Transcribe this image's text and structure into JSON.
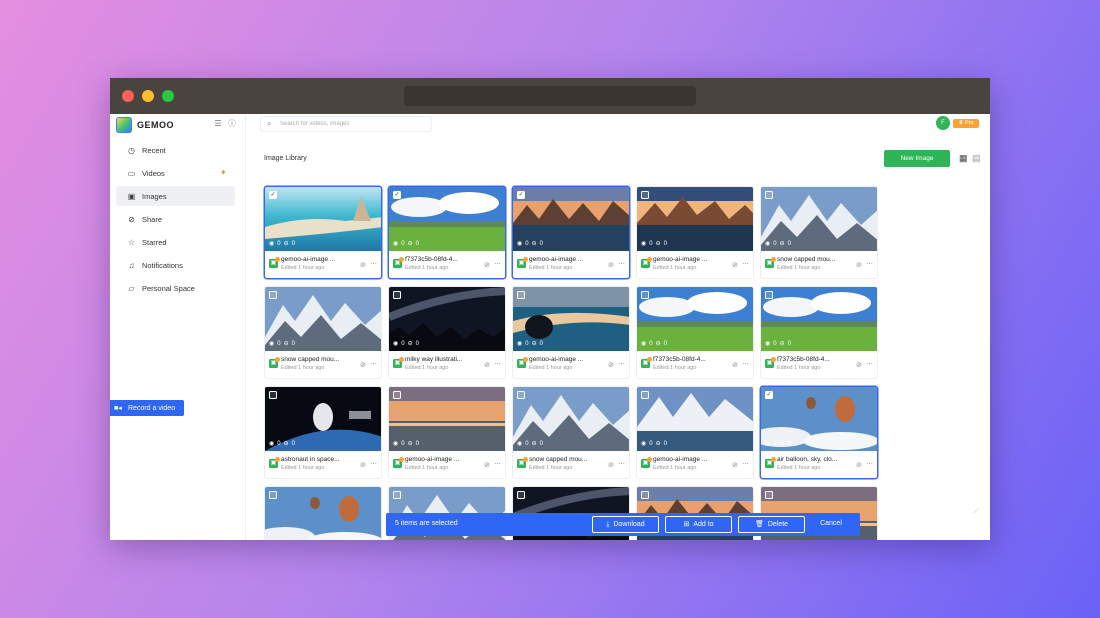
{
  "app": {
    "name": "GEMOO"
  },
  "sidebar": {
    "items": [
      {
        "label": "Recent",
        "icon": "clock-icon"
      },
      {
        "label": "Videos",
        "icon": "video-icon"
      },
      {
        "label": "Images",
        "icon": "image-icon",
        "active": true
      },
      {
        "label": "Share",
        "icon": "share-icon"
      },
      {
        "label": "Starred",
        "icon": "star-icon"
      },
      {
        "label": "Notifications",
        "icon": "bell-icon"
      },
      {
        "label": "Personal Space",
        "icon": "folder-icon"
      }
    ],
    "record_label": "Record a video"
  },
  "header": {
    "search_placeholder": "Search for videos, images",
    "avatar_initial": "F",
    "badge": "Pro"
  },
  "main": {
    "title": "Image Library",
    "new_button": "New Image"
  },
  "cards": [
    {
      "name": "gemoo-ai-image ...",
      "edited": "Edited 1 hour ago",
      "views": "0",
      "comments": "0",
      "selected": true,
      "scene": "beach"
    },
    {
      "name": "f7373c5b-08fd-4...",
      "edited": "Edited 1 hour ago",
      "views": "0",
      "comments": "0",
      "selected": true,
      "scene": "meadow"
    },
    {
      "name": "gemoo-ai-image ...",
      "edited": "Edited 1 hour ago",
      "views": "0",
      "comments": "0",
      "selected": true,
      "scene": "lake-sunset"
    },
    {
      "name": "gemoo-ai-image ...",
      "edited": "Edited 1 hour ago",
      "views": "0",
      "comments": "0",
      "selected": false,
      "scene": "lake-sunset2"
    },
    {
      "name": "snow capped mou...",
      "edited": "Edited 1 hour ago",
      "views": "0",
      "comments": "0",
      "selected": false,
      "scene": "snow"
    },
    {
      "name": "snow capped mou...",
      "edited": "Edited 1 hour ago",
      "views": "0",
      "comments": "0",
      "selected": false,
      "scene": "snow"
    },
    {
      "name": "milky way illustrati...",
      "edited": "Edited 1 hour ago",
      "views": "0",
      "comments": "0",
      "selected": false,
      "scene": "milkyway"
    },
    {
      "name": "gemoo-ai-image ...",
      "edited": "Edited 1 hour ago",
      "views": "0",
      "comments": "0",
      "selected": false,
      "scene": "lagoon"
    },
    {
      "name": "f7373c5b-08fd-4...",
      "edited": "Edited 1 hour ago",
      "views": "0",
      "comments": "0",
      "selected": false,
      "scene": "meadow"
    },
    {
      "name": "f7373c5b-08fd-4...",
      "edited": "Edited 1 hour ago",
      "views": "0",
      "comments": "0",
      "selected": false,
      "scene": "meadow"
    },
    {
      "name": "astronaut in space...",
      "edited": "Edited 1 hour ago",
      "views": "0",
      "comments": "0",
      "selected": false,
      "scene": "space"
    },
    {
      "name": "gemoo-ai-image ...",
      "edited": "Edited 1 hour ago",
      "views": "0",
      "comments": "0",
      "selected": false,
      "scene": "sea-sunset"
    },
    {
      "name": "snow capped mou...",
      "edited": "Edited 1 hour ago",
      "views": "0",
      "comments": "0",
      "selected": false,
      "scene": "snow"
    },
    {
      "name": "gemoo-ai-image ...",
      "edited": "Edited 1 hour ago",
      "views": "0",
      "comments": "0",
      "selected": false,
      "scene": "snow-lake"
    },
    {
      "name": "air balloon, sky, clo...",
      "edited": "Edited 1 hour ago",
      "views": "0",
      "comments": "0",
      "selected": true,
      "scene": "balloon"
    },
    {
      "name": "",
      "edited": "",
      "views": "",
      "comments": "",
      "selected": false,
      "scene": "balloon"
    },
    {
      "name": "",
      "edited": "",
      "views": "",
      "comments": "",
      "selected": false,
      "scene": "snow"
    },
    {
      "name": "",
      "edited": "",
      "views": "",
      "comments": "",
      "selected": false,
      "scene": "milkyway"
    },
    {
      "name": "",
      "edited": "",
      "views": "",
      "comments": "",
      "selected": false,
      "scene": "lake-sunset"
    },
    {
      "name": "",
      "edited": "",
      "views": "",
      "comments": "",
      "selected": false,
      "scene": "sea-sunset"
    }
  ],
  "selection_bar": {
    "text": "5 items are selected",
    "download": "Download",
    "add_to": "Add to",
    "delete": "Delete",
    "cancel": "Cancel"
  },
  "colors": {
    "accent": "#2f66f3",
    "green": "#2fb557",
    "selected_border": "#3669e9"
  }
}
